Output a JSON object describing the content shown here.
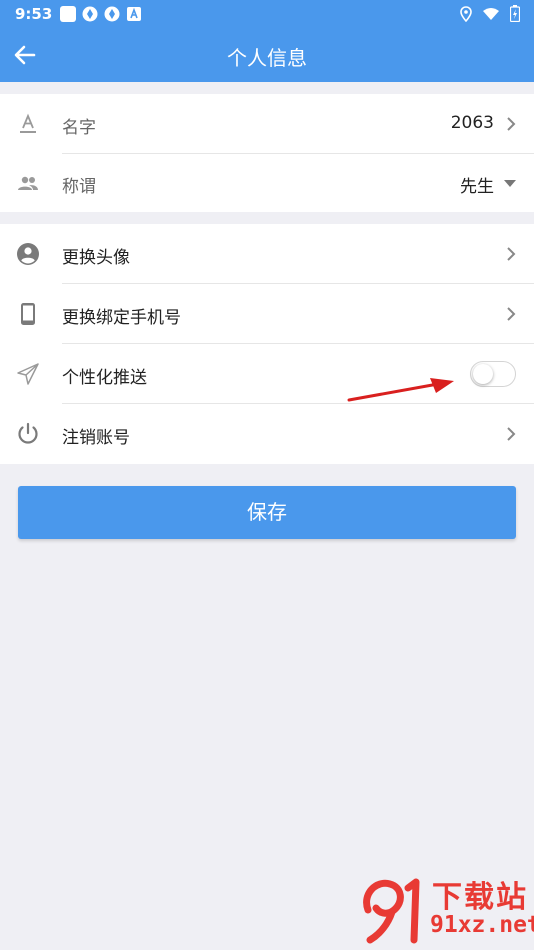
{
  "status_bar": {
    "time": "9:53"
  },
  "header": {
    "title": "个人信息"
  },
  "profile_section": {
    "name": {
      "label": "名字",
      "value": "2063"
    },
    "salutation": {
      "label": "称谓",
      "value": "先生"
    }
  },
  "settings_section": {
    "change_avatar": "更换头像",
    "change_phone": "更换绑定手机号",
    "personalized_push": "个性化推送",
    "push_enabled": false,
    "deactivate_account": "注销账号"
  },
  "save_button": "保存",
  "watermark": {
    "brand": "下载站",
    "site": "91xz.net"
  },
  "colors": {
    "primary": "#4a98ec",
    "annotation_arrow": "#d9201f",
    "watermark": "#e83a34"
  }
}
